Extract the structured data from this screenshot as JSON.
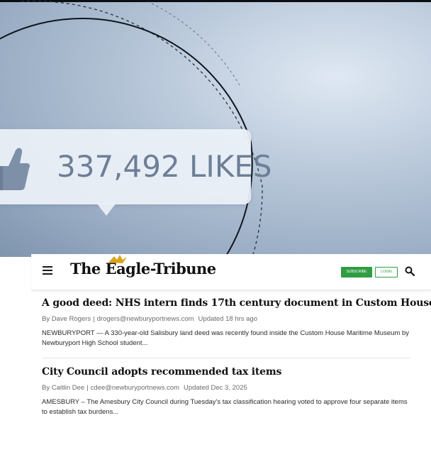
{
  "hero": {
    "likes_text": "337,492 LIKES",
    "thumb_icon": "thumbs-up-icon",
    "colors": {
      "background": "#a9bbd0",
      "bubble": "#ecf1f8",
      "text": "#6d7f97"
    }
  },
  "header": {
    "menu_icon": "hamburger-menu-icon",
    "logo_text": "The Eagle-Tribune",
    "subscribe_label": "SUBSCRIBE",
    "login_label": "LOGIN",
    "search_icon": "search-icon",
    "accent_color": "#2f9d43"
  },
  "articles": [
    {
      "headline": "A good deed: NHS intern finds 17th century document in Custom House",
      "author": "By Dave Rogers",
      "email": "drogers@newburyportnews.com",
      "updated": "Updated 18 hrs ago",
      "excerpt": "NEWBURYPORT — A 330-year-old Salisbury land deed was recently found inside the Custom House Maritime Museum by Newburyport High School student..."
    },
    {
      "headline": "City Council adopts recommended tax items",
      "author": "By Caitlin Dee",
      "email": "cdee@newburyportnews.com",
      "updated": "Updated Dec 3, 2025",
      "excerpt": "AMESBURY – The Amesbury City Council during Tuesday's tax classification hearing voted to approve four separate items to establish tax burdens..."
    }
  ]
}
